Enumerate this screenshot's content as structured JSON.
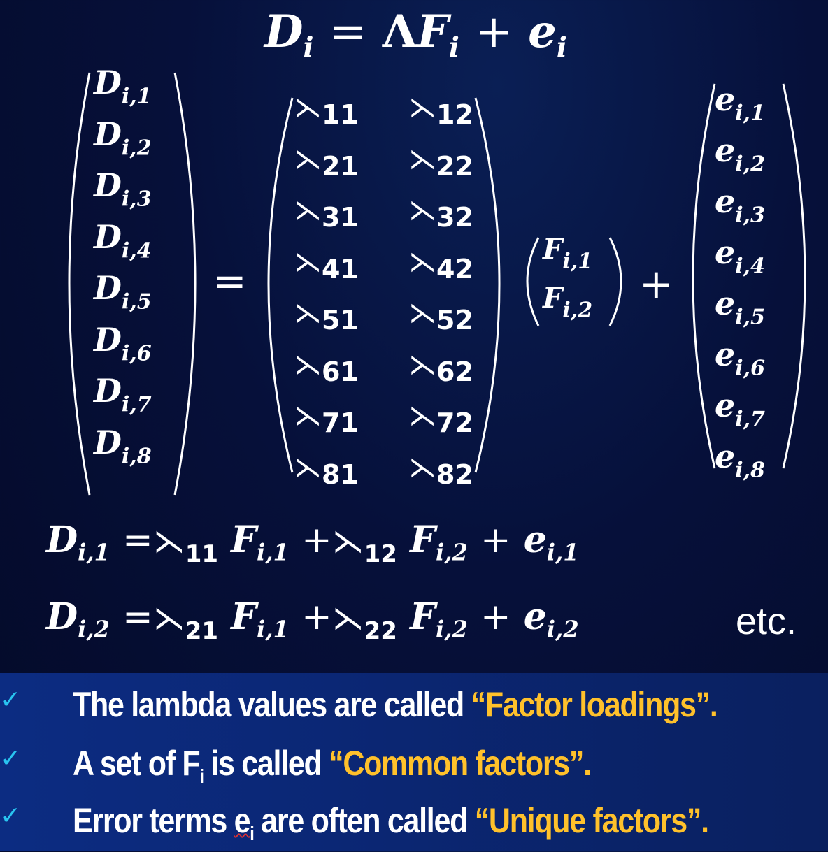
{
  "title_equation": {
    "D": "D",
    "i1": "i",
    "eq": "=",
    "Lambda": "Λ",
    "F": "F",
    "i2": "i",
    "plus": "+",
    "e": "e",
    "i3": "i"
  },
  "D_vector": [
    {
      "sym": "D",
      "sub": "i,1"
    },
    {
      "sym": "D",
      "sub": "i,2"
    },
    {
      "sym": "D",
      "sub": "i,3"
    },
    {
      "sym": "D",
      "sub": "i,4"
    },
    {
      "sym": "D",
      "sub": "i,5"
    },
    {
      "sym": "D",
      "sub": "i,6"
    },
    {
      "sym": "D",
      "sub": "i,7"
    },
    {
      "sym": "D",
      "sub": "i,8"
    }
  ],
  "equals_sign": "=",
  "lambda_glyph": "⋋",
  "lambda_matrix": {
    "col1": [
      "11",
      "21",
      "31",
      "41",
      "51",
      "61",
      "71",
      "81"
    ],
    "col2": [
      "12",
      "22",
      "32",
      "42",
      "52",
      "62",
      "72",
      "82"
    ]
  },
  "F_vector": [
    {
      "sym": "F",
      "sub": "i,1"
    },
    {
      "sym": "F",
      "sub": "i,2"
    }
  ],
  "plus_sign": "+",
  "e_vector": [
    {
      "sym": "e",
      "sub": "i,1"
    },
    {
      "sym": "e",
      "sub": "i,2"
    },
    {
      "sym": "e",
      "sub": "i,3"
    },
    {
      "sym": "e",
      "sub": "i,4"
    },
    {
      "sym": "e",
      "sub": "i,5"
    },
    {
      "sym": "e",
      "sub": "i,6"
    },
    {
      "sym": "e",
      "sub": "i,7"
    },
    {
      "sym": "e",
      "sub": "i,8"
    }
  ],
  "row_equations": [
    {
      "D": "D",
      "Dsub": "i,1",
      "eq": "=",
      "l1": "11",
      "F1": "F",
      "F1sub": "i,1",
      "plus1": "+",
      "l2": "12",
      "F2": "F",
      "F2sub": "i,2",
      "plus2": "+",
      "e": "e",
      "esub": "i,1"
    },
    {
      "D": "D",
      "Dsub": "i,2",
      "eq": "=",
      "l1": "21",
      "F1": "F",
      "F1sub": "i,1",
      "plus1": "+",
      "l2": "22",
      "F2": "F",
      "F2sub": "i,2",
      "plus2": "+",
      "e": "e",
      "esub": "i,2"
    }
  ],
  "etc_text": "etc.",
  "check_glyph": "✓",
  "bullets": {
    "b1": {
      "text": "The lambda values are called ",
      "highlight": "“Factor loadings”."
    },
    "b2": {
      "pre": "A set of F",
      "sub": "i",
      "post": " is called ",
      "highlight": "“Common factors”."
    },
    "b3": {
      "pre": "Error terms ",
      "e": "e",
      "sub": "i",
      "post": " are often called ",
      "highlight": "“Unique factors”."
    }
  },
  "colors": {
    "background": "#06103a",
    "band": "#0b2775",
    "highlight": "#ffc12b",
    "check": "#29c4f0",
    "text": "#ffffff"
  }
}
